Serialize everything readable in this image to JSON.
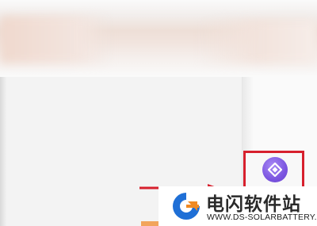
{
  "watermark": {
    "title": "电闪软件站",
    "url": "WWW.DS-SOLARBATTERY.COM"
  },
  "colors": {
    "highlight_border": "#d7202d",
    "app_icon": "#7b55e0",
    "arrow": "#d7202d",
    "logo_blue": "#1f6fd6",
    "logo_orange": "#f08a24"
  },
  "icons": {
    "sidebar_app": "purple-diamond-app-icon",
    "arrow": "red-arrow-icon",
    "logo": "site-logo-icon"
  }
}
